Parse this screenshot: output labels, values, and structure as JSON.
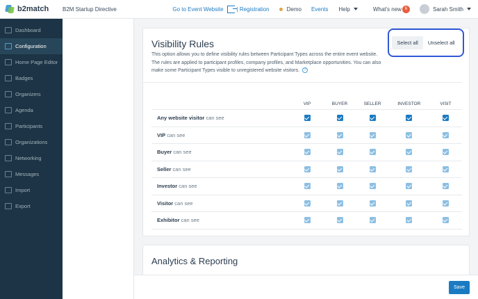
{
  "header": {
    "logo_text": "b2match",
    "event_name": "B2M Startup Directive",
    "go_to_event": "Go to Event Website",
    "registration": "| Registration",
    "demo": "Demo",
    "events": "Events",
    "help": "Help",
    "whats_new": "What's new",
    "whats_new_count": "6",
    "user_name": "Sarah Smith",
    "colors": {
      "link": "#1b7bc2",
      "badge": "#e85d3f",
      "demo_dot": "#e0a44a"
    }
  },
  "sidebar": {
    "items": [
      {
        "label": "Dashboard",
        "icon": "dashboard-icon",
        "active": false
      },
      {
        "label": "Configuration",
        "icon": "gear-icon",
        "active": true
      },
      {
        "label": "Home Page Editor",
        "icon": "page-icon",
        "active": false
      },
      {
        "label": "Badges",
        "icon": "badge-icon",
        "active": false
      },
      {
        "label": "Organizers",
        "icon": "people-icon",
        "active": false
      },
      {
        "label": "Agenda",
        "icon": "calendar-icon",
        "active": false
      },
      {
        "label": "Participants",
        "icon": "person-icon",
        "active": false
      },
      {
        "label": "Organizations",
        "icon": "building-icon",
        "active": false
      },
      {
        "label": "Networking",
        "icon": "network-icon",
        "active": false
      },
      {
        "label": "Messages",
        "icon": "mail-icon",
        "active": false
      },
      {
        "label": "Import",
        "icon": "import-icon",
        "active": false
      },
      {
        "label": "Export",
        "icon": "export-icon",
        "active": false
      }
    ],
    "colors": {
      "background": "#1c3445",
      "active": "#28465a"
    }
  },
  "visibility": {
    "title": "Visibility Rules",
    "description": "This option allows you to define visibility rules between Participant Types across the entire event website. The rules are applied to participant profiles, company profiles, and Marketplace opportunities. You can also make some Participant Types visible to unregistered website visitors.",
    "select_all": "Select all",
    "unselect_all": "Unselect all",
    "columns": [
      "VIP",
      "BUYER",
      "SELLER",
      "INVESTOR",
      "VISIT"
    ],
    "can_see": "can see",
    "rows": [
      {
        "label": "Any website visitor",
        "checked": [
          true,
          true,
          true,
          true,
          true
        ],
        "enabled": true
      },
      {
        "label": "VIP",
        "checked": [
          true,
          true,
          true,
          true,
          true
        ],
        "enabled": false
      },
      {
        "label": "Buyer",
        "checked": [
          true,
          true,
          true,
          true,
          true
        ],
        "enabled": false
      },
      {
        "label": "Seller",
        "checked": [
          true,
          true,
          true,
          true,
          true
        ],
        "enabled": false
      },
      {
        "label": "Investor",
        "checked": [
          true,
          true,
          true,
          true,
          true
        ],
        "enabled": false
      },
      {
        "label": "Visitor",
        "checked": [
          true,
          true,
          true,
          true,
          true
        ],
        "enabled": false
      },
      {
        "label": "Exhibitor",
        "checked": [
          true,
          true,
          true,
          true,
          true
        ],
        "enabled": false
      }
    ],
    "colors": {
      "checkbox": "#1b7bc2",
      "checkbox_disabled": "#8cbfe3",
      "highlight": "#2f58d6"
    }
  },
  "analytics": {
    "title": "Analytics & Reporting"
  },
  "footer": {
    "save": "Save"
  }
}
